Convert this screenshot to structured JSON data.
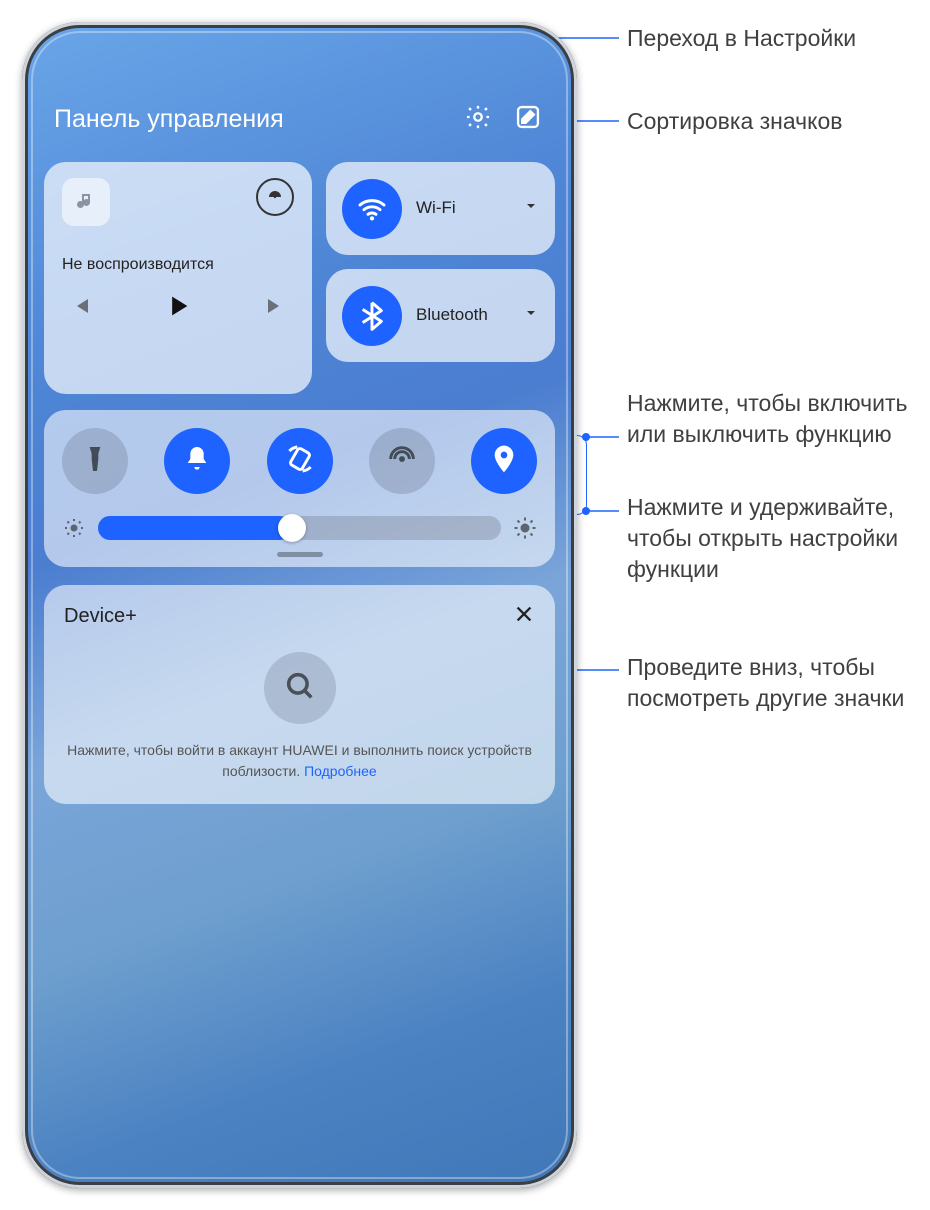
{
  "callouts": {
    "settings": "Переход в Настройки",
    "sort": "Сортировка значков",
    "tap": "Нажмите, чтобы включить или выключить функцию",
    "hold": "Нажмите и удерживайте, чтобы открыть настройки функции",
    "swipe": "Проведите вниз, чтобы посмотреть другие значки"
  },
  "header": {
    "title": "Панель управления"
  },
  "music": {
    "status": "Не воспроизводится"
  },
  "tiles": {
    "wifi": {
      "label": "Wi-Fi",
      "active": true
    },
    "bluetooth": {
      "label": "Bluetooth",
      "active": true
    }
  },
  "toggles": {
    "items": [
      "torch",
      "sound",
      "rotate",
      "hotspot",
      "location"
    ],
    "states": [
      false,
      true,
      true,
      false,
      true
    ]
  },
  "brightness": {
    "value_pct": 48
  },
  "device_plus": {
    "title": "Device+",
    "hint_prefix": "Нажмите, чтобы войти в аккаунт HUAWEI и выполнить поиск устройств поблизости. ",
    "hint_link": "Подробнее"
  }
}
